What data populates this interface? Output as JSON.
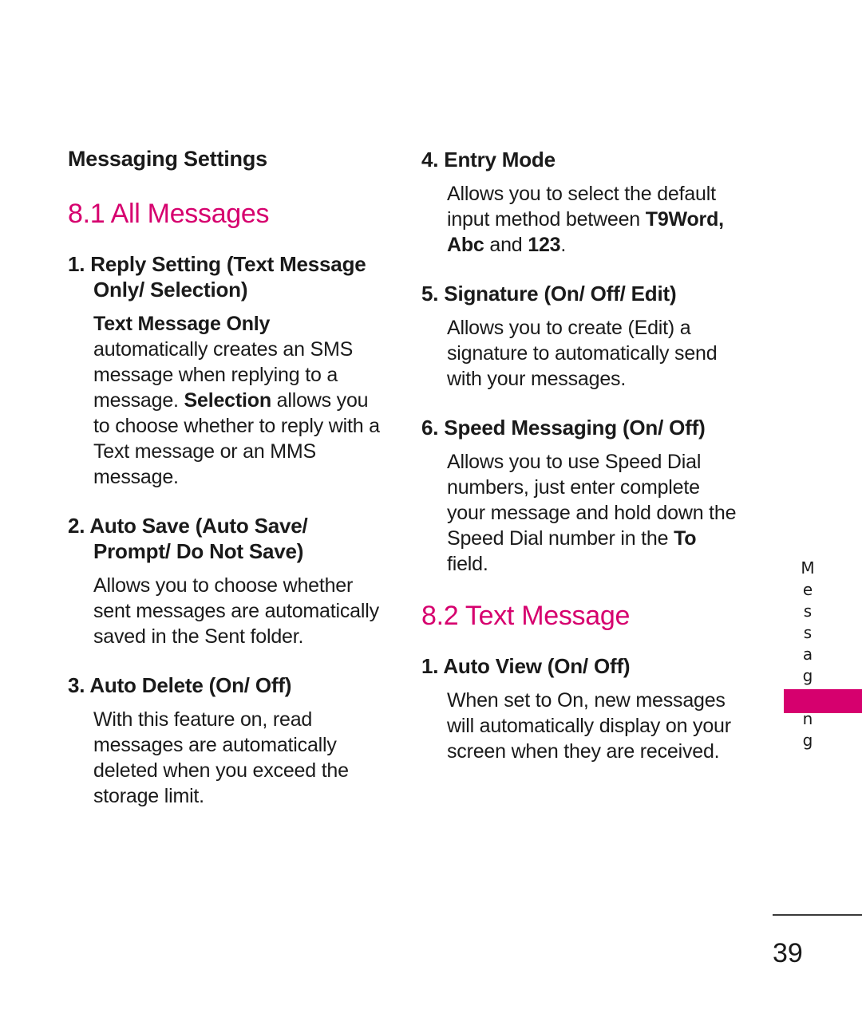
{
  "colors": {
    "accent_magenta": "#D6006E",
    "text": "#1a1a1a",
    "page_background": "#ffffff"
  },
  "running_head": "Messaging Settings",
  "side_tab": {
    "label": "Messaging"
  },
  "footer": {
    "page_number": "39"
  },
  "left_column": {
    "section": {
      "number": "8.1",
      "title": "8.1 All Messages"
    },
    "items": [
      {
        "title": "1. Reply Setting (Text Message Only/ Selection)",
        "body_parts": [
          {
            "text": "Text Message Only",
            "bold": true
          },
          {
            "text": " automatically creates an SMS message when replying to a message. ",
            "bold": false
          },
          {
            "text": "Selection",
            "bold": true
          },
          {
            "text": " allows you to choose whether to reply with a Text message or an MMS message.",
            "bold": false
          }
        ]
      },
      {
        "title": "2. Auto Save (Auto Save/ Prompt/ Do Not Save)",
        "body_parts": [
          {
            "text": "Allows you to choose whether sent messages are automatically saved in the Sent folder.",
            "bold": false
          }
        ]
      },
      {
        "title": "3. Auto Delete (On/ Off)",
        "body_parts": [
          {
            "text": "With this feature on, read messages are automatically deleted when you exceed the storage limit.",
            "bold": false
          }
        ]
      }
    ]
  },
  "right_column": {
    "items_before_section": [
      {
        "title": "4. Entry Mode",
        "body_parts": [
          {
            "text": "Allows you to select the default input method between ",
            "bold": false
          },
          {
            "text": "T9Word, Abc",
            "bold": true
          },
          {
            "text": " and ",
            "bold": false
          },
          {
            "text": "123",
            "bold": true
          },
          {
            "text": ".",
            "bold": false
          }
        ]
      },
      {
        "title": "5. Signature (On/ Off/ Edit)",
        "body_parts": [
          {
            "text": "Allows you to create (Edit) a signature to automatically send with your messages.",
            "bold": false
          }
        ]
      },
      {
        "title": "6. Speed Messaging (On/ Off)",
        "body_parts": [
          {
            "text": "Allows you to use Speed Dial numbers, just enter complete your message and hold down the Speed Dial number in the ",
            "bold": false
          },
          {
            "text": "To",
            "bold": true
          },
          {
            "text": " field.",
            "bold": false
          }
        ]
      }
    ],
    "section": {
      "number": "8.2",
      "title": "8.2 Text Message"
    },
    "items_after_section": [
      {
        "title": "1. Auto View (On/ Off)",
        "body_parts": [
          {
            "text": "When set to On, new messages will automatically display on your screen when they are received.",
            "bold": false
          }
        ]
      }
    ]
  }
}
